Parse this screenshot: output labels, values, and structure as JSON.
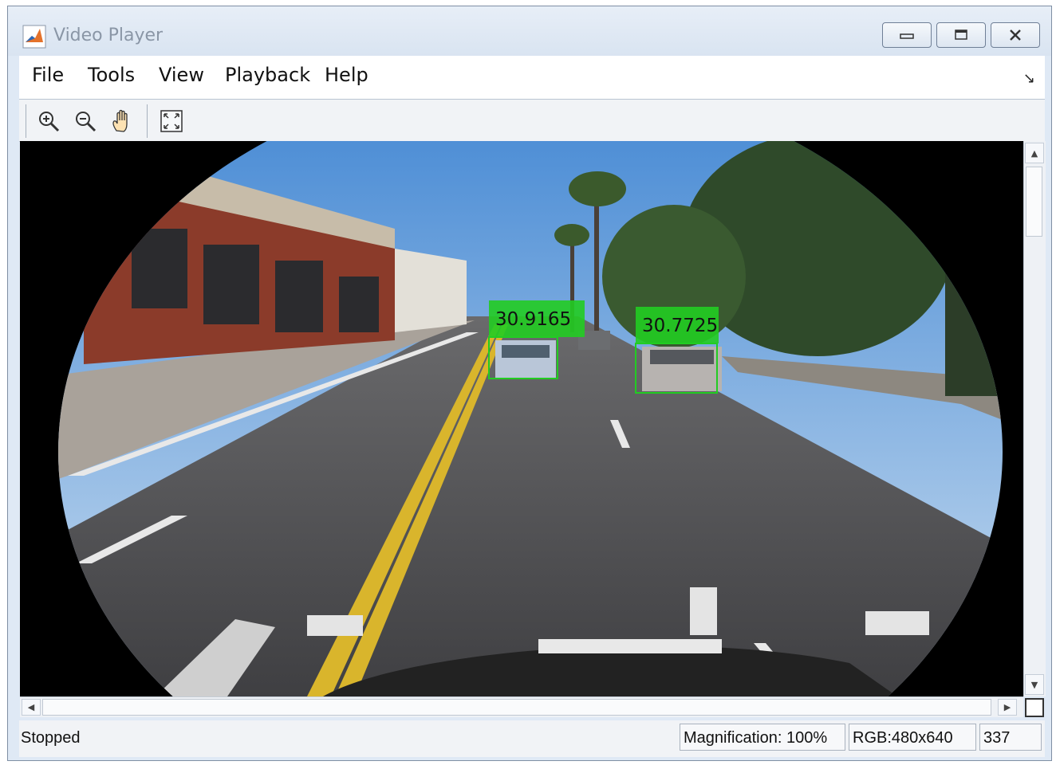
{
  "window": {
    "title": "Video Player"
  },
  "menu": {
    "items": [
      "File",
      "Tools",
      "View",
      "Playback",
      "Help"
    ],
    "corner_icon": "dock-arrow-icon"
  },
  "toolbar": {
    "buttons": [
      "zoom-in-icon",
      "zoom-out-icon",
      "pan-hand-icon",
      "fit-to-view-icon"
    ]
  },
  "video": {
    "detections": [
      {
        "label": "30.9165"
      },
      {
        "label": "30.7725"
      }
    ],
    "box_color": "#22cc22"
  },
  "status": {
    "state": "Stopped",
    "magnification": "Magnification: 100%",
    "format": "RGB:480x640",
    "frame": "337"
  }
}
